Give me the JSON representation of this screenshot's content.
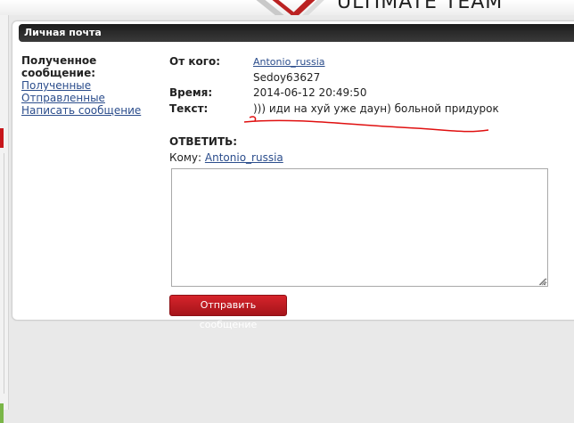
{
  "banner": {
    "text": "ULTIMATE TEAM"
  },
  "panel": {
    "title": "Личная почта"
  },
  "sidebar": {
    "title": "Полученное сообщение:",
    "links": [
      "Полученные",
      "Отправленные",
      "Написать сообщение"
    ]
  },
  "message": {
    "from_label": "От кого:",
    "from_user": "Antonio_russia",
    "from_extra": "Sedoy63627",
    "time_label": "Время:",
    "time_value": "2014-06-12 20:49:50",
    "text_label": "Текст:",
    "text_value": "))) иди на хуй уже даун) больной придурок"
  },
  "reply": {
    "heading": "ОТВЕТИТЬ:",
    "to_label": "Кому:",
    "to_user": "Antonio_russia",
    "body_value": "",
    "send_label": "Отправить сообщение"
  },
  "colors": {
    "header_bg": "#2a2a2a",
    "link": "#2b4d8c",
    "button": "#c41c22",
    "annotation": "#e01010"
  }
}
